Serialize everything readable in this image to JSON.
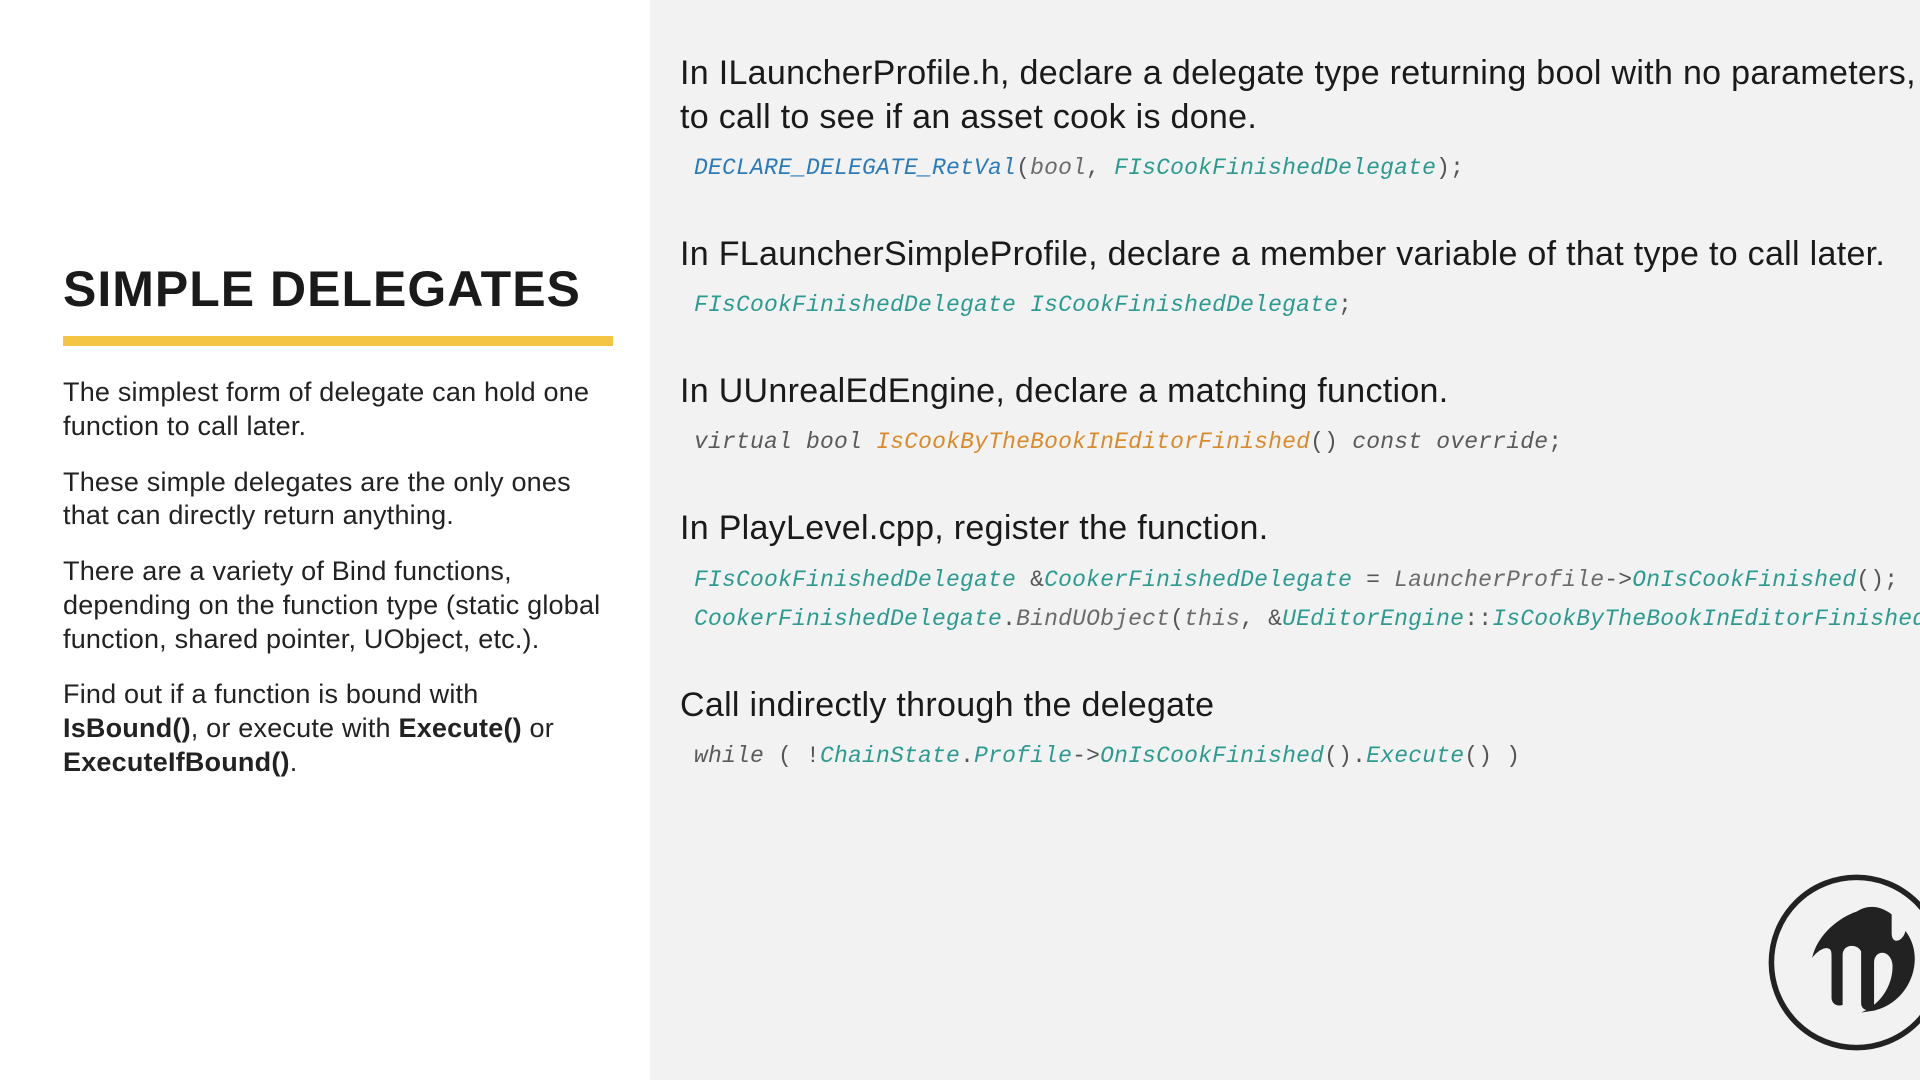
{
  "left": {
    "title": "SIMPLE DELEGATES",
    "p1": "The simplest form of delegate can hold one function to call later.",
    "p2": "These simple delegates are the only ones that can directly return anything.",
    "p3": "There are a variety of Bind functions, depending on the function type (static global function, shared pointer, UObject, etc.).",
    "p4a": "Find out if a function is bound with ",
    "p4b": "IsBound()",
    "p4c": ", or execute with ",
    "p4d": "Execute()",
    "p4e": " or ",
    "p4f": "ExecuteIfBound()",
    "p4g": "."
  },
  "right": {
    "s1": {
      "desc": "In ILauncherProfile.h, declare a delegate type returning bool with no parameters, to call to see if an asset cook is done.",
      "tok": {
        "a": "DECLARE_DELEGATE_RetVal",
        "b": "(",
        "c": "bool",
        "d": ", ",
        "e": "FIsCookFinishedDelegate",
        "f": ");"
      }
    },
    "s2": {
      "desc": "In FLauncherSimpleProfile, declare a member variable of that type to call later.",
      "tok": {
        "a": "FIsCookFinishedDelegate",
        "b": " ",
        "c": "IsCookFinishedDelegate",
        "d": ";"
      }
    },
    "s3": {
      "desc": "In UUnrealEdEngine, declare a matching function.",
      "tok": {
        "a": "virtual",
        "b": " ",
        "c": "bool",
        "d": " ",
        "e": "IsCookByTheBookInEditorFinished",
        "f": "()",
        "g": " ",
        "h": "const",
        "i": " ",
        "j": "override",
        "k": ";"
      }
    },
    "s4": {
      "desc": "In PlayLevel.cpp, register the function.",
      "l1": {
        "a": "FIsCookFinishedDelegate",
        "b": " &",
        "c": "CookerFinishedDelegate",
        "d": " = ",
        "e": "LauncherProfile",
        "f": "->",
        "g": "OnIsCookFinished",
        "h": "();"
      },
      "l2": {
        "a": "CookerFinishedDelegate",
        "b": ".",
        "c": "BindUObject",
        "d": "(",
        "e": "this",
        "f": ", &",
        "g": "UEditorEngine",
        "h": "::",
        "i": "IsCookByTheBookInEditorFinished",
        "j": ");"
      }
    },
    "s5": {
      "desc": "Call indirectly through the delegate",
      "tok": {
        "a": "while",
        "b": " ( !",
        "c": "ChainState",
        "d": ".",
        "e": "Profile",
        "f": "->",
        "g": "OnIsCookFinished",
        "h": "().",
        "i": "Execute",
        "j": "() )"
      }
    }
  },
  "logo_name": "unreal-engine-logo"
}
